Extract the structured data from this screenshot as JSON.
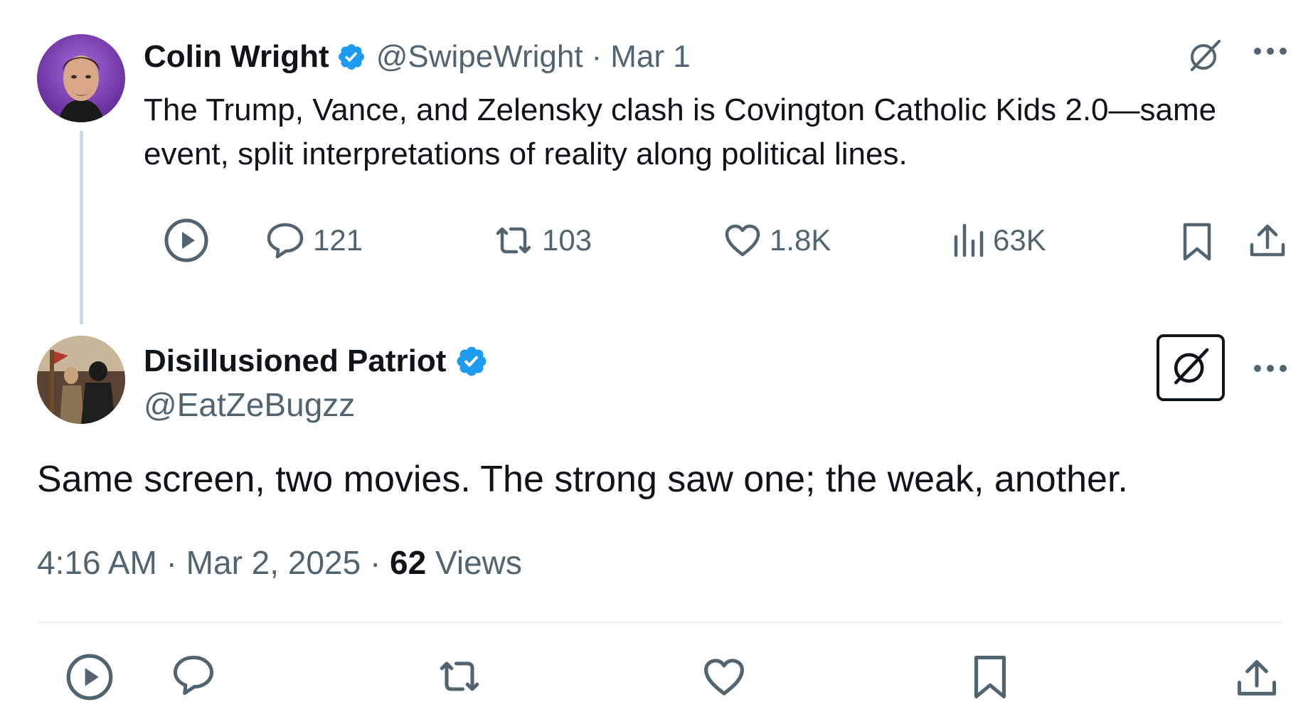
{
  "tweet1": {
    "author_name": "Colin Wright",
    "handle": "@SwipeWright",
    "separator": "·",
    "date": "Mar 1",
    "text": "The Trump, Vance, and Zelensky clash is Covington Catholic Kids 2.0—same event, split interpretations of reality along political lines.",
    "replies": "121",
    "reposts": "103",
    "likes": "1.8K",
    "views": "63K",
    "icons": [
      "verified-badge-icon",
      "grok-icon",
      "more-icon",
      "play-icon",
      "reply-icon",
      "repost-icon",
      "like-icon",
      "views-icon",
      "bookmark-icon",
      "share-icon"
    ]
  },
  "tweet2": {
    "author_name": "Disillusioned Patriot",
    "handle": "@EatZeBugzz",
    "text": "Same screen, two movies. The strong saw one; the weak, another.",
    "time": "4:16 AM",
    "sep1": "·",
    "date": "Mar 2, 2025",
    "sep2": "·",
    "views_count": "62",
    "views_label": "Views",
    "icons": [
      "verified-badge-icon",
      "grok-icon",
      "more-icon",
      "play-icon",
      "reply-icon",
      "repost-icon",
      "like-icon",
      "bookmark-icon",
      "share-icon"
    ]
  },
  "colors": {
    "text": "#0f1419",
    "secondary": "#536471",
    "verified": "#1d9bf0",
    "thread_line": "#cfd9de",
    "divider": "#eff3f4"
  }
}
